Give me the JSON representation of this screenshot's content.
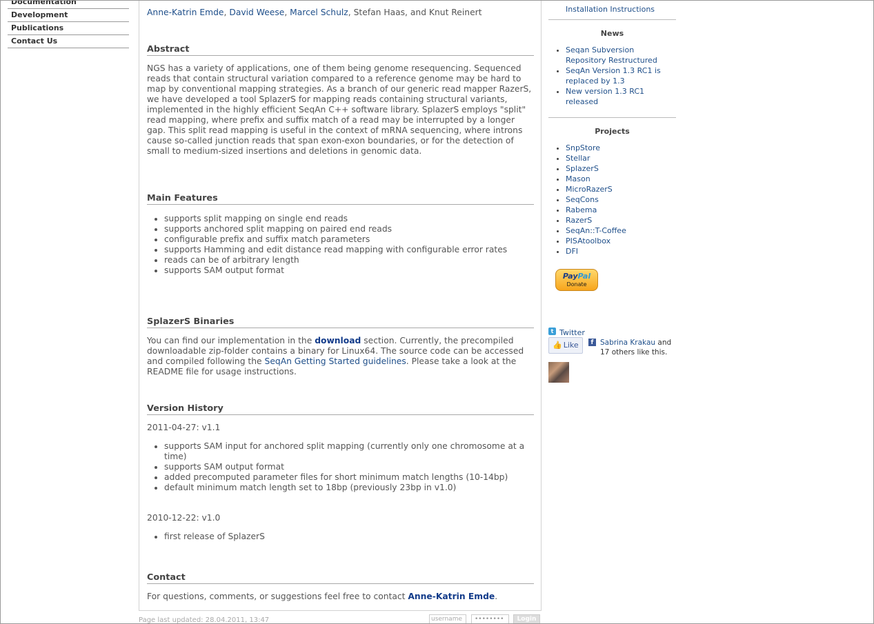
{
  "nav": {
    "items": [
      {
        "label": "Documentation"
      },
      {
        "label": "Development"
      },
      {
        "label": "Publications"
      },
      {
        "label": "Contact Us"
      }
    ]
  },
  "main": {
    "authors": {
      "linked": [
        "Anne-Katrin Emde",
        "David Weese",
        "Marcel Schulz"
      ],
      "plain": "Stefan Haas, and Knut Reinert",
      "sep": ", "
    },
    "abstract": {
      "heading": "Abstract",
      "text": "NGS has a variety of applications, one of them being genome resequencing. Sequenced reads that contain structural variation compared to a reference genome may be hard to map by conventional mapping strategies. As a branch of our generic read mapper RazerS, we have developed a tool SplazerS for mapping reads containing structural variants, implemented in the highly efficient SeqAn C++ software library. SplazerS employs \"split\" read mapping, where prefix and suffix match of a read may be interrupted by a longer gap. This split read mapping is useful in the context of mRNA sequencing, where introns cause so-called junction reads that span exon-exon boundaries, or for the detection of small to medium-sized insertions and deletions in genomic data."
    },
    "features": {
      "heading": "Main Features",
      "items": [
        "supports split mapping on single end reads",
        "supports anchored split mapping on paired end reads",
        "configurable prefix and suffix match parameters",
        "supports Hamming and edit distance read mapping with configurable error rates",
        "reads can be of arbitrary length",
        "supports SAM output format"
      ]
    },
    "binaries": {
      "heading": "SplazerS Binaries",
      "t1": "You can find our implementation in the ",
      "download_link": "download",
      "t2": " section. Currently, the precompiled downloadable zip-folder contains a binary for Linux64. The source code can be accessed and compiled following the ",
      "guide_link": "SeqAn Getting Started guidelines",
      "t3": ". Please take a look at the README file for usage instructions."
    },
    "history": {
      "heading": "Version History",
      "v11_label": "2011-04-27: v1.1",
      "v11_items": [
        "supports SAM input for anchored split mapping (currently only one chromosome at a time)",
        "supports SAM output format",
        "added precomputed parameter files for short minimum match lengths (10-14bp)",
        "default minimum match length set to 18bp (previously 23bp in v1.0)"
      ],
      "v10_label": "2010-12-22: v1.0",
      "v10_items": [
        "first release of SplazerS"
      ]
    },
    "contact": {
      "heading": "Contact",
      "t1": "For questions, comments, or suggestions feel free to contact ",
      "link": "Anne-Katrin Emde",
      "t2": "."
    }
  },
  "footer": {
    "updated": "Page last updated: 28.04.2011, 13:47",
    "username_placeholder": "username",
    "password_mask": "••••••••",
    "login_label": "Login"
  },
  "right": {
    "install_link": "Installation Instructions",
    "news_heading": "News",
    "news": [
      "Seqan Subversion Repository Restructured",
      "SeqAn Version 1.3 RC1 is replaced by 1.3",
      "New version 1.3 RC1 released"
    ],
    "projects_heading": "Projects",
    "projects": [
      "SnpStore",
      "Stellar",
      "SplazerS",
      "Mason",
      "MicroRazerS",
      "SeqCons",
      "Rabema",
      "RazerS",
      "SeqAn::T-Coffee",
      "PISAtoolbox",
      "DFI"
    ],
    "paypal": {
      "pay": "Pay",
      "pal": "Pal",
      "donate": "Donate"
    },
    "twitter_label": "Twitter",
    "like_label": "Like",
    "fb_person": "Sabrina Krakau",
    "fb_rest_1": " and",
    "fb_rest_2": "17 others like this."
  },
  "colors": {
    "link": "#1f4f8a",
    "strong_link": "#123b8a",
    "text": "#555555"
  }
}
